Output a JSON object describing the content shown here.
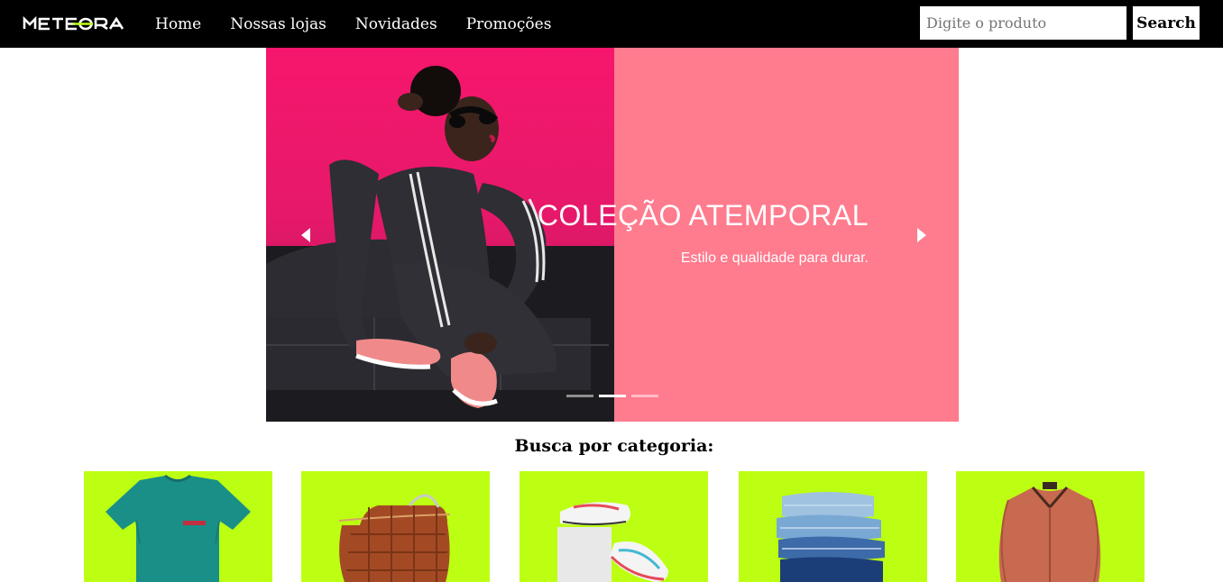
{
  "header": {
    "logo_text": "METEORA",
    "nav": [
      {
        "label": "Home"
      },
      {
        "label": "Nossas lojas"
      },
      {
        "label": "Novidades"
      },
      {
        "label": "Promoções"
      }
    ],
    "search": {
      "placeholder": "Digite o produto",
      "value": "",
      "button_label": "Search"
    }
  },
  "carousel": {
    "title": "COLEÇÃO ATEMPORAL",
    "subtitle": "Estilo e qualidade para durar.",
    "active_index": 1,
    "slide_count": 3,
    "accent_color": "#ff7b8e",
    "photo_background_color": "#f6176c",
    "prev_icon": "caret-left-icon",
    "next_icon": "caret-right-icon"
  },
  "categories": {
    "heading": "Busca por categoria:",
    "card_color": "#bdff12",
    "items": [
      {
        "icon": "tshirt-icon"
      },
      {
        "icon": "handbag-icon"
      },
      {
        "icon": "sneakers-icon"
      },
      {
        "icon": "jeans-stack-icon"
      },
      {
        "icon": "jacket-icon"
      }
    ]
  }
}
